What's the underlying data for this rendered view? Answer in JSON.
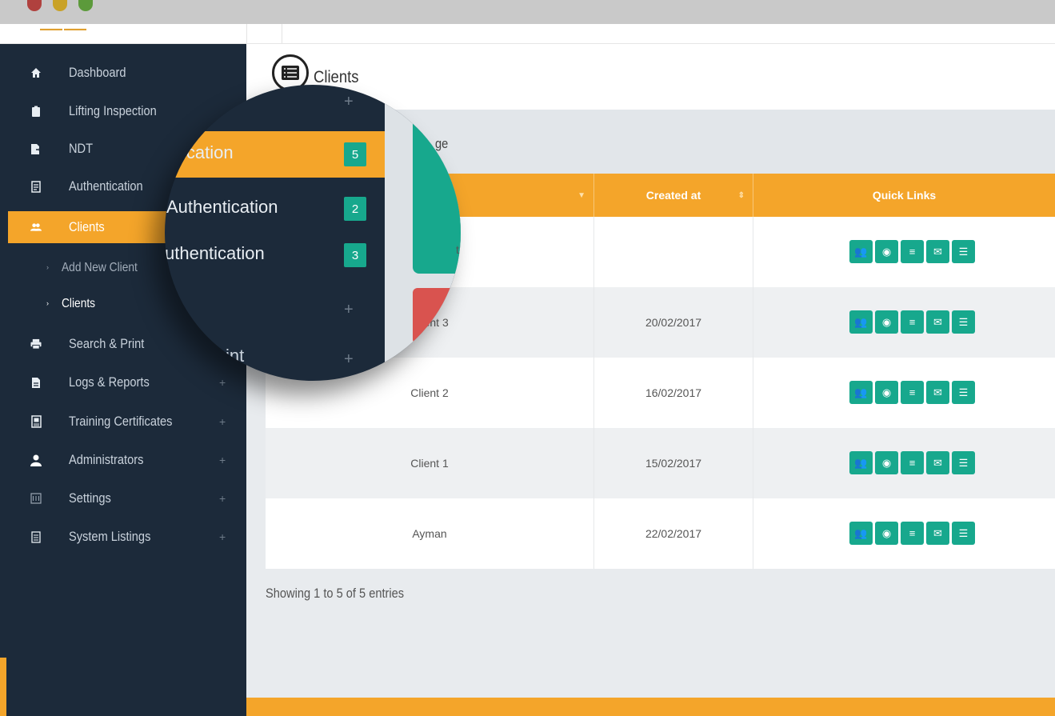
{
  "sidebar": {
    "items": [
      {
        "label": "Dashboard",
        "icon": "home-icon"
      },
      {
        "label": "Lifting Inspection",
        "icon": "clipboard-icon"
      },
      {
        "label": "NDT",
        "icon": "file-export-icon"
      },
      {
        "label": "Authentication",
        "icon": "file-text-icon"
      },
      {
        "label": "Clients",
        "icon": "users-icon"
      },
      {
        "label": "Search & Print",
        "icon": "print-icon"
      },
      {
        "label": "Logs & Reports",
        "icon": "report-icon"
      },
      {
        "label": "Training Certificates",
        "icon": "certificate-icon"
      },
      {
        "label": "Administrators",
        "icon": "user-icon"
      },
      {
        "label": "Settings",
        "icon": "settings-icon"
      },
      {
        "label": "System Listings",
        "icon": "listing-icon"
      }
    ],
    "plus": "+",
    "sub_items": [
      {
        "label": "Add New Client"
      },
      {
        "label": "Clients"
      }
    ],
    "sub_arrow": "›"
  },
  "header": {
    "title": "Clients"
  },
  "panel": {
    "title_fragment": "ge"
  },
  "table": {
    "columns": [
      "Created at",
      "Quick Links"
    ],
    "rows": [
      {
        "name": "",
        "name_fragment": "t",
        "created": ""
      },
      {
        "name": "Client 3",
        "name_fragment": "nt 3",
        "created": "20/02/2017"
      },
      {
        "name": "Client 2",
        "created": "16/02/2017"
      },
      {
        "name": "Client 1",
        "created": "15/02/2017"
      },
      {
        "name": "Ayman",
        "created": "22/02/2017"
      }
    ]
  },
  "footer": {
    "showing": "Showing 1 to 5 of 5 entries"
  },
  "magnifier": {
    "rows": [
      {
        "label": "ication",
        "badge": "5"
      },
      {
        "label": "Authentication",
        "badge": "2"
      },
      {
        "label": "uthentication",
        "badge": "3"
      }
    ],
    "fragment_int": "int",
    "plus": "+"
  },
  "colors": {
    "sidebar_bg": "#1c2a3a",
    "accent": "#f4a52a",
    "teal": "#17a88d",
    "red": "#d9534f"
  }
}
